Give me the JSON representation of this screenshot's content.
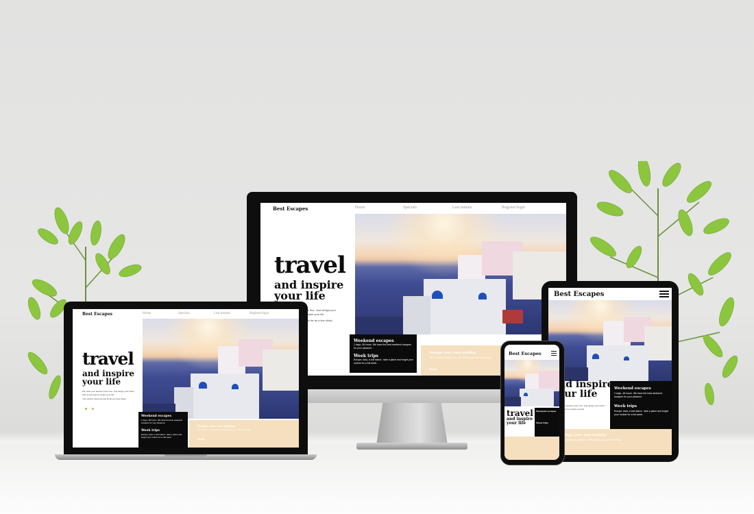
{
  "site": {
    "brand": "Best Escapes",
    "nav": [
      "Home",
      "Specials",
      "Last minute",
      "Register/login"
    ],
    "headline": "travel",
    "subheadline_1": "and inspire",
    "subheadline_2": "your life",
    "intro_1": "We invite your dreams come true. Just design your travel with us and start to inspire your life.",
    "intro_2": "Your perfect travel are just as far as a few clicks.",
    "card_weekend_title": "Weekend escapes",
    "card_weekend_text": "2 days, 48 hours. We have the best weekend escapes for your pleasure.",
    "card_week_title": "Week trips",
    "card_week_text": "Europe, Asia, a lost island.. take a plane and forget your routine for a full week.",
    "card_design_title": "Design your own holiday",
    "card_design_text": "Tell us what you want and we'll design your perfect holiday.",
    "card_design_link": "Book"
  },
  "colors": {
    "background": "#e4e4e3",
    "accent_beige": "#f5dfbe",
    "dark_card": "#0b0b0b",
    "plant_green": "#8cc63f"
  },
  "icons": {
    "menu": "hamburger-menu-icon"
  }
}
